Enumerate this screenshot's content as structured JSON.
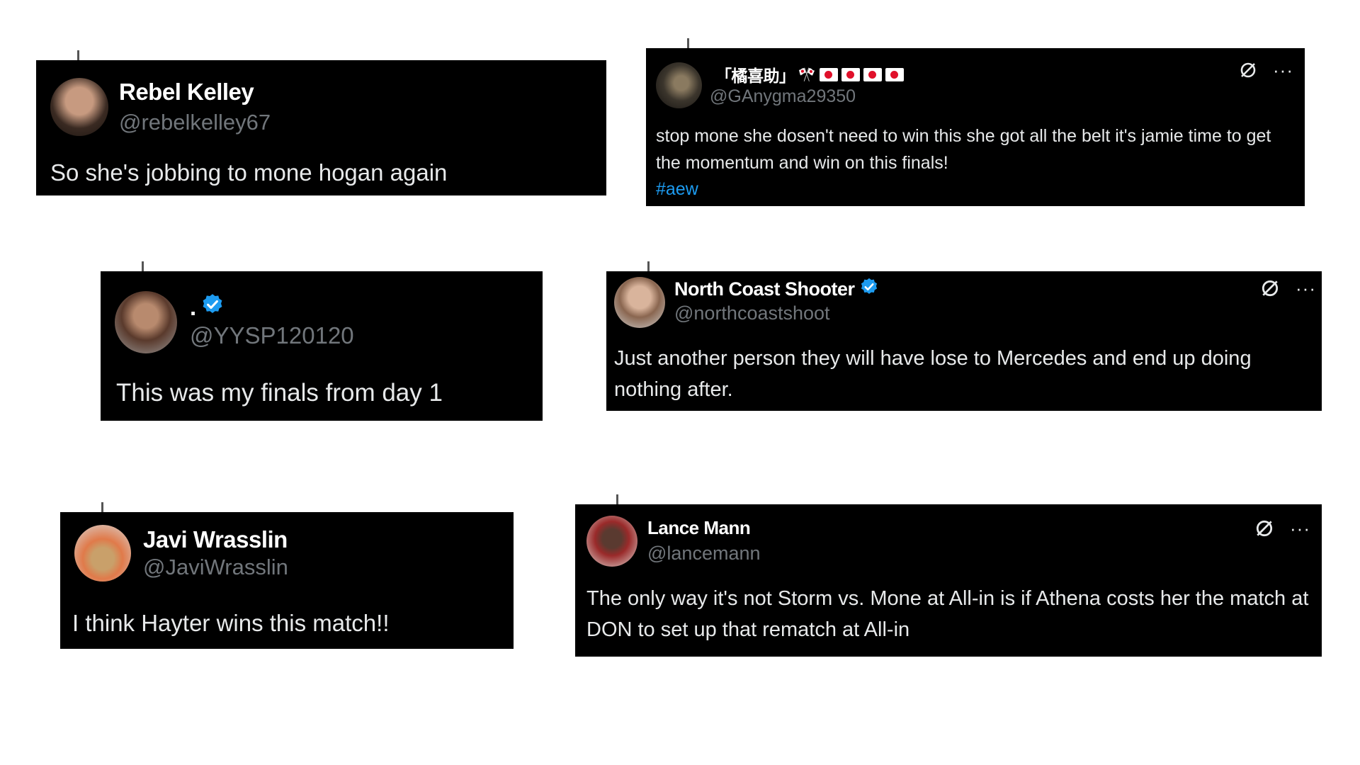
{
  "tweets": [
    {
      "name": "Rebel Kelley",
      "handle": "@rebelkelley67",
      "body": "So she's jobbing to mone hogan again"
    },
    {
      "name": "「橘喜助」",
      "name_emoji": "🎌",
      "handle": "@GAnygma29350",
      "body": "stop mone she dosen't need to win this she got all the belt it's jamie time to get the momentum and win on this finals!",
      "hashtag": "#aew"
    },
    {
      "name": ".",
      "handle": "@YYSP120120",
      "body": "This was my finals from day 1"
    },
    {
      "name": "North Coast Shooter",
      "handle": "@northcoastshoot",
      "body": "Just another person they will have lose to Mercedes and end up doing nothing after."
    },
    {
      "name": "Javi Wrasslin",
      "handle": "@JaviWrasslin",
      "body": "I think Hayter wins this match!!"
    },
    {
      "name": "Lance Mann",
      "handle": "@lancemann",
      "body": "The only way it's not Storm vs. Mone at All-in is if Athena costs her the match at DON to set up that rematch at All-in"
    }
  ],
  "icons": {
    "verified": "verified-badge-icon",
    "grok": "grok-icon",
    "more": "more-options-icon"
  },
  "colors": {
    "background": "#000000",
    "handle": "#71767b",
    "text": "#e7e9ea",
    "link": "#1d9bf0",
    "verified": "#1d9bf0",
    "flag_red": "#e0102a"
  }
}
